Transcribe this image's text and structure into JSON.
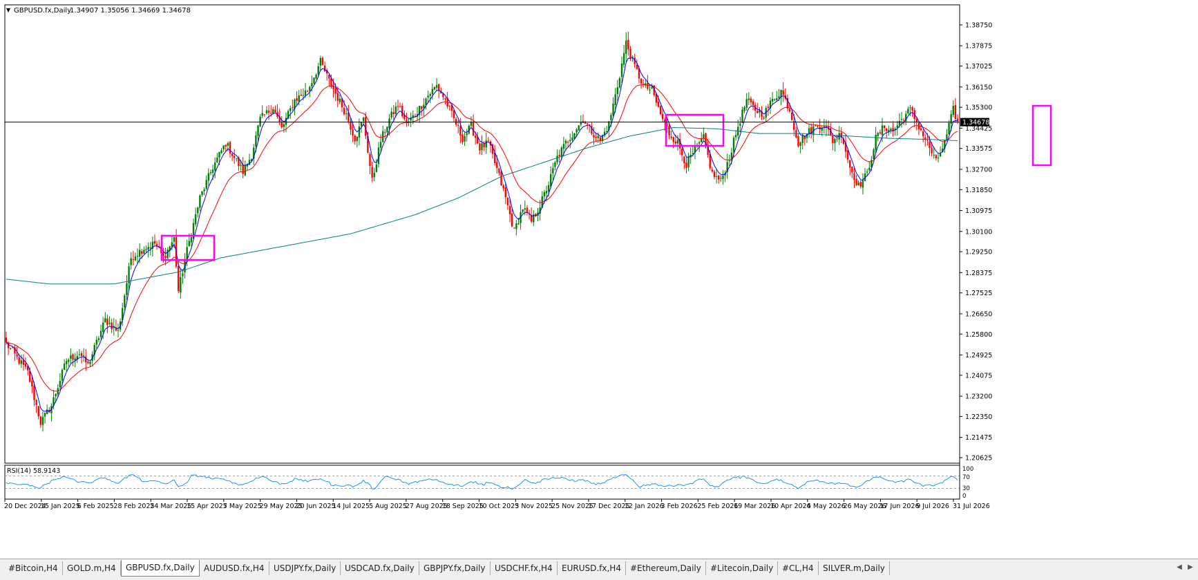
{
  "header": {
    "symbol": "GBPUSD.fx,Daily",
    "ohlc": "1.34907 1.35056 1.34669 1.34678"
  },
  "indicator": {
    "label": "RSI(14) 58.9143",
    "levels": [
      "100",
      "70",
      "30",
      "0"
    ]
  },
  "tabs": [
    {
      "label": "#Bitcoin,H4",
      "active": false
    },
    {
      "label": "GOLD.m,H4",
      "active": false
    },
    {
      "label": "GBPUSD.fx,Daily",
      "active": true
    },
    {
      "label": "AUDUSD.fx,H4",
      "active": false
    },
    {
      "label": "USDJPY.fx,Daily",
      "active": false
    },
    {
      "label": "USDCAD.fx,Daily",
      "active": false
    },
    {
      "label": "GBPJPY.fx,Daily",
      "active": false
    },
    {
      "label": "USDCHF.fx,H4",
      "active": false
    },
    {
      "label": "EURUSD.fx,H4",
      "active": false
    },
    {
      "label": "#Ethereum,Daily",
      "active": false
    },
    {
      "label": "#Litecoin,Daily",
      "active": false
    },
    {
      "label": "#CL,H4",
      "active": false
    },
    {
      "label": "SILVER.m,Daily",
      "active": false
    }
  ],
  "chart_data": {
    "type": "candlestick",
    "symbol": "GBPUSD.fx",
    "timeframe": "Daily",
    "current_price": 1.34678,
    "current_price_label": "1.34678",
    "ylim": [
      1.20625,
      1.3875
    ],
    "y_ticks": [
      "1.38750",
      "1.37875",
      "1.37025",
      "1.36150",
      "1.35300",
      "1.34425",
      "1.33575",
      "1.32700",
      "1.31850",
      "1.30975",
      "1.30100",
      "1.29250",
      "1.28375",
      "1.27525",
      "1.26650",
      "1.25800",
      "1.24925",
      "1.24075",
      "1.23200",
      "1.22350",
      "1.21475",
      "1.20625"
    ],
    "x_ticks": [
      "20 Dec 2024",
      "15 Jan 2025",
      "6 Feb 2025",
      "28 Feb 2025",
      "24 Mar 2025",
      "15 Apr 2025",
      "7 May 2025",
      "29 May 2025",
      "20 Jun 2025",
      "14 Jul 2025",
      "5 Aug 2025",
      "27 Aug 2025",
      "18 Sep 2025",
      "10 Oct 2025",
      "3 Nov 2025",
      "25 Nov 2025",
      "17 Dec 2025",
      "12 Jan 2026",
      "3 Feb 2026",
      "25 Feb 2026",
      "19 Mar 2026",
      "10 Apr 2026",
      "4 May 2026",
      "26 May 2026",
      "17 Jun 2026",
      "9 Jul 2026",
      "31 Jul 2026"
    ],
    "close_path": [
      [
        0,
        1.254
      ],
      [
        10,
        1.242
      ],
      [
        16,
        1.221
      ],
      [
        21,
        1.228
      ],
      [
        28,
        1.247
      ],
      [
        34,
        1.25
      ],
      [
        38,
        1.245
      ],
      [
        46,
        1.264
      ],
      [
        52,
        1.259
      ],
      [
        58,
        1.29
      ],
      [
        64,
        1.294
      ],
      [
        69,
        1.296
      ],
      [
        73,
        1.29
      ],
      [
        78,
        1.298
      ],
      [
        80,
        1.276
      ],
      [
        84,
        1.293
      ],
      [
        90,
        1.315
      ],
      [
        96,
        1.328
      ],
      [
        102,
        1.338
      ],
      [
        106,
        1.332
      ],
      [
        110,
        1.326
      ],
      [
        114,
        1.333
      ],
      [
        118,
        1.348
      ],
      [
        124,
        1.353
      ],
      [
        128,
        1.344
      ],
      [
        134,
        1.356
      ],
      [
        140,
        1.36
      ],
      [
        146,
        1.372
      ],
      [
        150,
        1.364
      ],
      [
        154,
        1.357
      ],
      [
        158,
        1.35
      ],
      [
        162,
        1.34
      ],
      [
        166,
        1.348
      ],
      [
        170,
        1.322
      ],
      [
        174,
        1.339
      ],
      [
        178,
        1.348
      ],
      [
        182,
        1.354
      ],
      [
        186,
        1.346
      ],
      [
        190,
        1.35
      ],
      [
        196,
        1.358
      ],
      [
        200,
        1.362
      ],
      [
        204,
        1.356
      ],
      [
        208,
        1.348
      ],
      [
        212,
        1.34
      ],
      [
        216,
        1.345
      ],
      [
        220,
        1.336
      ],
      [
        224,
        1.338
      ],
      [
        228,
        1.327
      ],
      [
        232,
        1.315
      ],
      [
        236,
        1.301
      ],
      [
        240,
        1.311
      ],
      [
        244,
        1.305
      ],
      [
        248,
        1.312
      ],
      [
        252,
        1.321
      ],
      [
        256,
        1.332
      ],
      [
        260,
        1.338
      ],
      [
        264,
        1.343
      ],
      [
        268,
        1.348
      ],
      [
        272,
        1.343
      ],
      [
        276,
        1.339
      ],
      [
        280,
        1.346
      ],
      [
        284,
        1.362
      ],
      [
        288,
        1.38
      ],
      [
        292,
        1.37
      ],
      [
        296,
        1.362
      ],
      [
        300,
        1.36
      ],
      [
        304,
        1.35
      ],
      [
        308,
        1.342
      ],
      [
        312,
        1.338
      ],
      [
        316,
        1.329
      ],
      [
        320,
        1.335
      ],
      [
        324,
        1.34
      ],
      [
        328,
        1.325
      ],
      [
        332,
        1.322
      ],
      [
        336,
        1.332
      ],
      [
        340,
        1.345
      ],
      [
        344,
        1.356
      ],
      [
        348,
        1.352
      ],
      [
        352,
        1.35
      ],
      [
        356,
        1.356
      ],
      [
        360,
        1.36
      ],
      [
        364,
        1.352
      ],
      [
        368,
        1.338
      ],
      [
        372,
        1.342
      ],
      [
        376,
        1.345
      ],
      [
        380,
        1.346
      ],
      [
        384,
        1.339
      ],
      [
        388,
        1.342
      ],
      [
        392,
        1.328
      ],
      [
        396,
        1.32
      ],
      [
        400,
        1.325
      ],
      [
        404,
        1.34
      ],
      [
        408,
        1.345
      ],
      [
        412,
        1.343
      ],
      [
        416,
        1.348
      ],
      [
        420,
        1.352
      ],
      [
        424,
        1.345
      ],
      [
        428,
        1.338
      ],
      [
        432,
        1.33
      ],
      [
        436,
        1.338
      ],
      [
        440,
        1.352
      ],
      [
        442,
        1.3468
      ]
    ],
    "series": [
      {
        "name": "",
        "color": "#0000ff",
        "role": "fast moving average"
      },
      {
        "name": "",
        "color": "#ff0000",
        "role": "slow moving average"
      },
      {
        "name": "",
        "color": "#008080",
        "role": "long moving average",
        "values": [
          [
            0,
            1.281
          ],
          [
            20,
            1.279
          ],
          [
            50,
            1.279
          ],
          [
            80,
            1.284
          ],
          [
            100,
            1.29
          ],
          [
            130,
            1.295
          ],
          [
            160,
            1.3
          ],
          [
            190,
            1.308
          ],
          [
            210,
            1.315
          ],
          [
            230,
            1.324
          ],
          [
            250,
            1.33
          ],
          [
            270,
            1.336
          ],
          [
            290,
            1.341
          ],
          [
            310,
            1.3445
          ],
          [
            330,
            1.344
          ],
          [
            350,
            1.342
          ],
          [
            370,
            1.342
          ],
          [
            390,
            1.341
          ],
          [
            410,
            1.34
          ],
          [
            430,
            1.3395
          ],
          [
            442,
            1.339
          ]
        ]
      }
    ],
    "highlight_boxes_color": "#ff00ff"
  }
}
